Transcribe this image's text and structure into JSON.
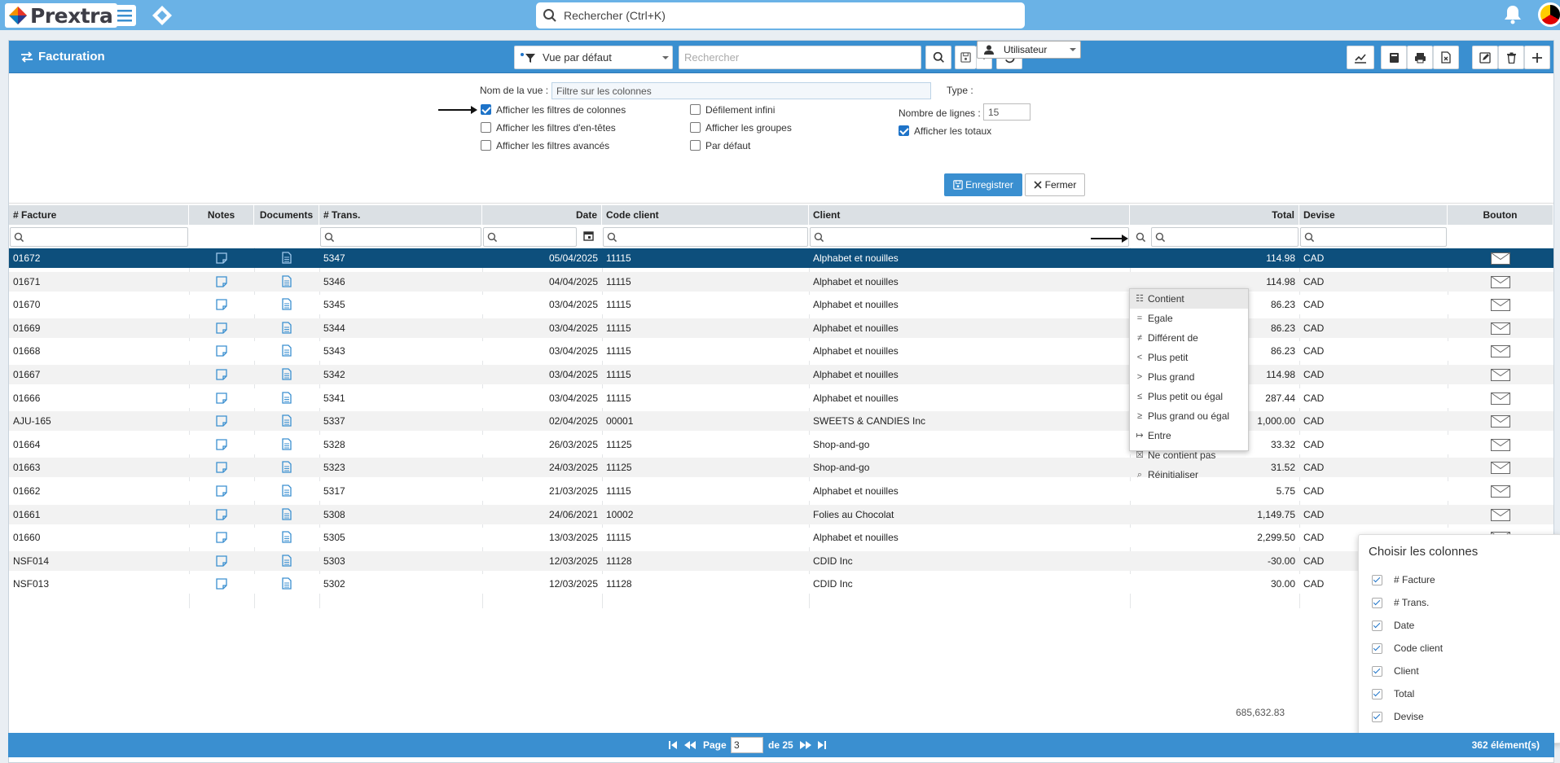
{
  "app": {
    "name": "Prextra"
  },
  "global_search": {
    "placeholder": "Rechercher (Ctrl+K)"
  },
  "panel": {
    "title": "Facturation",
    "view_select": "Vue par défaut",
    "search_placeholder": "Rechercher"
  },
  "form": {
    "view_name_label": "Nom de la vue :",
    "view_name_placeholder": "Filtre sur les colonnes",
    "type_label": "Type :",
    "type_value": "Utilisateur",
    "checkboxes": [
      {
        "label": "Afficher les filtres de colonnes",
        "checked": true
      },
      {
        "label": "Afficher les filtres d'en-têtes",
        "checked": false
      },
      {
        "label": "Afficher les filtres avancés",
        "checked": false
      },
      {
        "label": "Défilement infini",
        "checked": false
      },
      {
        "label": "Afficher les groupes",
        "checked": false
      },
      {
        "label": "Par défaut",
        "checked": false
      }
    ],
    "rows_label": "Nombre de lignes :",
    "rows_value": "15",
    "show_totals_label": "Afficher les totaux",
    "show_totals_checked": true,
    "save_label": "Enregistrer",
    "close_label": "Fermer"
  },
  "columns": [
    "# Facture",
    "Notes",
    "Documents",
    "# Trans.",
    "Date",
    "Code client",
    "Client",
    "Total",
    "Devise",
    "Bouton"
  ],
  "rows": [
    {
      "facture": "01672",
      "trans": "5347",
      "date": "05/04/2025",
      "code": "11115",
      "client": "Alphabet et nouilles",
      "total": "114.98",
      "devise": "CAD"
    },
    {
      "facture": "01671",
      "trans": "5346",
      "date": "04/04/2025",
      "code": "11115",
      "client": "Alphabet et nouilles",
      "total": "114.98",
      "devise": "CAD"
    },
    {
      "facture": "01670",
      "trans": "5345",
      "date": "03/04/2025",
      "code": "11115",
      "client": "Alphabet et nouilles",
      "total": "86.23",
      "devise": "CAD"
    },
    {
      "facture": "01669",
      "trans": "5344",
      "date": "03/04/2025",
      "code": "11115",
      "client": "Alphabet et nouilles",
      "total": "86.23",
      "devise": "CAD"
    },
    {
      "facture": "01668",
      "trans": "5343",
      "date": "03/04/2025",
      "code": "11115",
      "client": "Alphabet et nouilles",
      "total": "86.23",
      "devise": "CAD"
    },
    {
      "facture": "01667",
      "trans": "5342",
      "date": "03/04/2025",
      "code": "11115",
      "client": "Alphabet et nouilles",
      "total": "114.98",
      "devise": "CAD"
    },
    {
      "facture": "01666",
      "trans": "5341",
      "date": "03/04/2025",
      "code": "11115",
      "client": "Alphabet et nouilles",
      "total": "287.44",
      "devise": "CAD"
    },
    {
      "facture": "AJU-165",
      "trans": "5337",
      "date": "02/04/2025",
      "code": "00001",
      "client": "SWEETS & CANDIES Inc",
      "total": "1,000.00",
      "devise": "CAD"
    },
    {
      "facture": "01664",
      "trans": "5328",
      "date": "26/03/2025",
      "code": "11125",
      "client": "Shop-and-go",
      "total": "33.32",
      "devise": "CAD"
    },
    {
      "facture": "01663",
      "trans": "5323",
      "date": "24/03/2025",
      "code": "11125",
      "client": "Shop-and-go",
      "total": "31.52",
      "devise": "CAD"
    },
    {
      "facture": "01662",
      "trans": "5317",
      "date": "21/03/2025",
      "code": "11115",
      "client": "Alphabet et nouilles",
      "total": "5.75",
      "devise": "CAD"
    },
    {
      "facture": "01661",
      "trans": "5308",
      "date": "24/06/2021",
      "code": "10002",
      "client": "Folies au Chocolat",
      "total": "1,149.75",
      "devise": "CAD"
    },
    {
      "facture": "01660",
      "trans": "5305",
      "date": "13/03/2025",
      "code": "11115",
      "client": "Alphabet et nouilles",
      "total": "2,299.50",
      "devise": "CAD"
    },
    {
      "facture": "NSF014",
      "trans": "5303",
      "date": "12/03/2025",
      "code": "11128",
      "client": "CDID Inc",
      "total": "-30.00",
      "devise": "CAD"
    },
    {
      "facture": "NSF013",
      "trans": "5302",
      "date": "12/03/2025",
      "code": "11128",
      "client": "CDID Inc",
      "total": "30.00",
      "devise": "CAD"
    }
  ],
  "filter_menu": [
    {
      "icon": "contains-icon",
      "label": "Contient"
    },
    {
      "icon": "equals-icon",
      "label": "Egale"
    },
    {
      "icon": "not-equal-icon",
      "label": "Différent de"
    },
    {
      "icon": "less-than-icon",
      "label": "Plus petit"
    },
    {
      "icon": "greater-than-icon",
      "label": "Plus grand"
    },
    {
      "icon": "less-equal-icon",
      "label": "Plus petit ou égal"
    },
    {
      "icon": "greater-equal-icon",
      "label": "Plus grand ou égal"
    },
    {
      "icon": "between-icon",
      "label": "Entre"
    },
    {
      "icon": "not-contains-icon",
      "label": "Ne contient pas"
    },
    {
      "icon": "reset-icon",
      "label": "Réinitialiser"
    }
  ],
  "column_chooser": {
    "title": "Choisir les colonnes",
    "items": [
      "# Facture",
      "# Trans.",
      "Date",
      "Code client",
      "Client",
      "Total",
      "Devise"
    ]
  },
  "grand_total": "685,632.83",
  "pager": {
    "page_label": "Page",
    "page_value": "3",
    "of_label": "de 25",
    "count_label": "362 élément(s)"
  },
  "colors": {
    "header_blue": "#3a8fd0",
    "topbar_blue": "#6ab2e6",
    "selected_row": "#0d4f7c"
  }
}
